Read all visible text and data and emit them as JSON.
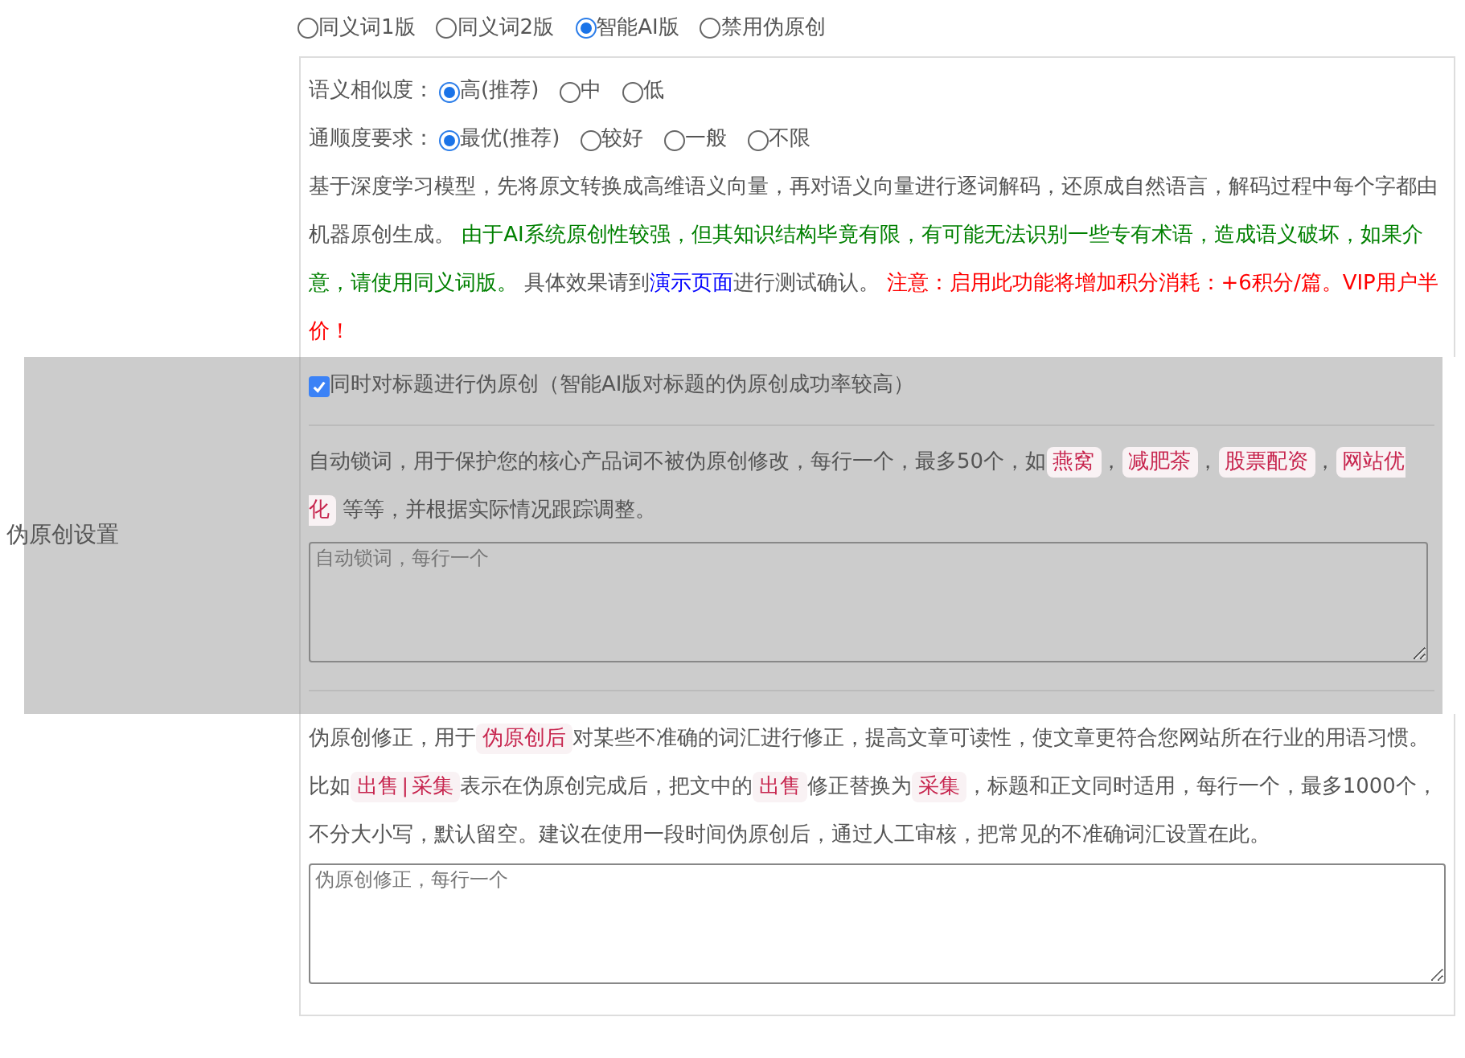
{
  "mode_options": [
    {
      "label": "同义词1版",
      "selected": false
    },
    {
      "label": "同义词2版",
      "selected": false
    },
    {
      "label": "智能AI版",
      "selected": true
    },
    {
      "label": "禁用伪原创",
      "selected": false
    }
  ],
  "similarity": {
    "label": "语义相似度：",
    "options": [
      {
        "label": "高(推荐)",
        "selected": true
      },
      {
        "label": "中",
        "selected": false
      },
      {
        "label": "低",
        "selected": false
      }
    ]
  },
  "fluency": {
    "label": "通顺度要求：",
    "options": [
      {
        "label": "最优(推荐)",
        "selected": true
      },
      {
        "label": "较好",
        "selected": false
      },
      {
        "label": "一般",
        "selected": false
      },
      {
        "label": "不限",
        "selected": false
      }
    ]
  },
  "ai_description": [
    {
      "kind": "text",
      "text": "基于深度学习模型，先将原文转换成高维语义向量，再对语义向量进行逐词解码，还原成自然语言，解码过程中每个字都由机器原创生成。 "
    },
    {
      "kind": "green",
      "text": "由于AI系统原创性较强，但其知识结构毕竟有限，有可能无法识别一些专有术语，造成语义破坏，如果介意，请使用同义词版。"
    },
    {
      "kind": "text",
      "text": " 具体效果请到"
    },
    {
      "kind": "link",
      "text": "演示页面"
    },
    {
      "kind": "text",
      "text": "进行测试确认。 "
    },
    {
      "kind": "red",
      "text": "注意：启用此功能将增加积分消耗：+6积分/篇。VIP用户半价！"
    }
  ],
  "section_label": "伪原创设置",
  "title_option": {
    "label": "同时对标题进行伪原创（智能AI版对标题的伪原创成功率较高）",
    "checked": true
  },
  "lock_description": [
    {
      "kind": "text",
      "text": "自动锁词，用于保护您的核心产品词不被伪原创修改，每行一个，最多50个，如"
    },
    {
      "kind": "code",
      "text": "燕窝"
    },
    {
      "kind": "text",
      "text": "，"
    },
    {
      "kind": "code",
      "text": "减肥茶"
    },
    {
      "kind": "text",
      "text": "，"
    },
    {
      "kind": "code",
      "text": "股票配资"
    },
    {
      "kind": "text",
      "text": "，"
    },
    {
      "kind": "code",
      "text": "网站优化"
    },
    {
      "kind": "text",
      "text": " 等等，并根据实际情况跟踪调整。"
    }
  ],
  "lock_field": {
    "placeholder": "自动锁词，每行一个"
  },
  "correction_description": [
    {
      "kind": "text",
      "text": "伪原创修正，用于"
    },
    {
      "kind": "code",
      "text": "伪原创后"
    },
    {
      "kind": "text",
      "text": "对某些不准确的词汇进行修正，提高文章可读性，使文章更符合您网站所在行业的用语习惯。比如"
    },
    {
      "kind": "code",
      "text": "出售|采集"
    },
    {
      "kind": "text",
      "text": "表示在伪原创完成后，把文中的"
    },
    {
      "kind": "code",
      "text": "出售"
    },
    {
      "kind": "text",
      "text": "修正替换为"
    },
    {
      "kind": "code",
      "text": "采集"
    },
    {
      "kind": "text",
      "text": "，标题和正文同时适用，每行一个，最多1000个，不分大小写，默认留空。建议在使用一段时间伪原创后，通过人工审核，把常见的不准确词汇设置在此。"
    }
  ],
  "correction_field": {
    "placeholder": "伪原创修正，每行一个"
  }
}
